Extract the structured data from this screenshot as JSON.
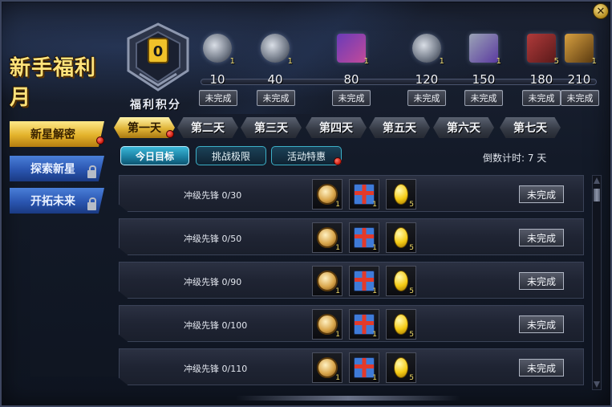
{
  "header": {
    "title_main": "新手",
    "title_sub": "福利月",
    "score_label": "福利积分",
    "emblem_value": "0"
  },
  "milestones": [
    {
      "value": "10",
      "count": "1",
      "status": "未完成"
    },
    {
      "value": "40",
      "count": "1",
      "status": "未完成"
    },
    {
      "value": "80",
      "count": "1",
      "status": "未完成"
    },
    {
      "value": "120",
      "count": "1",
      "status": "未完成"
    },
    {
      "value": "150",
      "count": "1",
      "status": "未完成"
    },
    {
      "value": "180",
      "count": "5",
      "status": "未完成"
    },
    {
      "value": "210",
      "count": "1",
      "status": "未完成"
    }
  ],
  "sidebar": {
    "items": [
      {
        "label": "新星解密"
      },
      {
        "label": "探索新星"
      },
      {
        "label": "开拓未来"
      }
    ]
  },
  "days": {
    "tabs": [
      "第一天",
      "第二天",
      "第三天",
      "第四天",
      "第五天",
      "第六天",
      "第七天"
    ]
  },
  "subtabs": {
    "items": [
      "今日目标",
      "挑战极限",
      "活动特惠"
    ]
  },
  "countdown": "倒数计时: 7 天",
  "tasks": [
    {
      "name": "冲级先锋 0/30",
      "rewards": [
        "1",
        "1",
        "5"
      ],
      "status": "未完成"
    },
    {
      "name": "冲级先锋 0/50",
      "rewards": [
        "1",
        "1",
        "5"
      ],
      "status": "未完成"
    },
    {
      "name": "冲级先锋 0/90",
      "rewards": [
        "1",
        "1",
        "5"
      ],
      "status": "未完成"
    },
    {
      "name": "冲级先锋 0/100",
      "rewards": [
        "1",
        "1",
        "5"
      ],
      "status": "未完成"
    },
    {
      "name": "冲级先锋 0/110",
      "rewards": [
        "1",
        "1",
        "5"
      ],
      "status": "未完成"
    }
  ],
  "close_label": "✕",
  "colors": {
    "gold": "#e3b22b",
    "blue": "#2a55b0",
    "cyan": "#1a7ea0",
    "red_dot": "#d01e10"
  }
}
